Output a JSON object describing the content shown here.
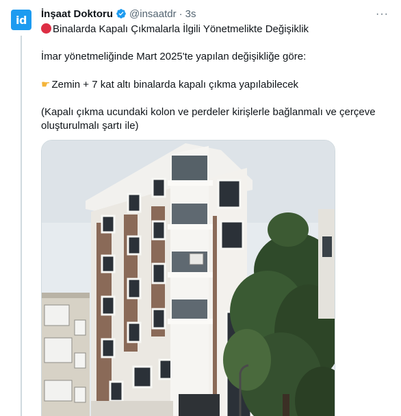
{
  "author": {
    "name": "İnşaat Doktoru",
    "handle": "@insaatdr",
    "separator": "·",
    "time": "3s",
    "avatar_text": "id",
    "verified_icon": "verified-badge-icon",
    "brand_color": "#1d9bf0"
  },
  "tweet": {
    "headline": "Binalarda Kapalı Çıkmalarla İlgili Yönetmelikte Değişiklik",
    "intro": "İmar yönetmeliğinde Mart 2025'te yapılan değişikliğe göre:",
    "point": "Zemin + 7 kat altı binalarda kapalı çıkma yapılabilecek",
    "note_line1": "(Kapalı çıkma ucundaki kolon ve perdeler kirişlerle bağlanmalı ve çerçeve",
    "note_line2": "oluşturulmalı şartı ile)",
    "headline_icon": "red-circle-icon",
    "point_icon": "pointing-hand-icon"
  },
  "more_icon": "more-options-icon",
  "colors": {
    "text": "#0f1419",
    "secondary": "#536471",
    "red_emoji": "#dd2e44"
  }
}
